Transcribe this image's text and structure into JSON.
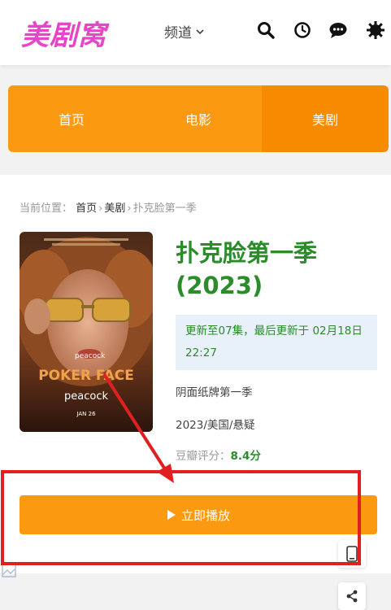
{
  "header": {
    "logo_text": "美剧窝",
    "logo_color": "#e545c6",
    "channel_label": "频道",
    "icons": [
      "search-icon",
      "history-icon",
      "chat-icon",
      "theme-icon"
    ]
  },
  "nav": {
    "items": [
      {
        "label": "首页",
        "active": false
      },
      {
        "label": "电影",
        "active": false
      },
      {
        "label": "美剧",
        "active": true
      }
    ],
    "color": "#fb9a10",
    "active_color": "#f88a00"
  },
  "breadcrumb": {
    "prefix": "当前位置：",
    "home": "首页",
    "category": "美剧",
    "current": "扑克脸第一季"
  },
  "show": {
    "title": "扑克脸第一季(2023)",
    "update_note": "更新至07集，最后更新于 02月18日 22:27",
    "alt_name": "阴面纸牌第一季",
    "meta": "2023/美国/悬疑",
    "rating_label": "豆瓣评分：",
    "rating_value": "8.4分"
  },
  "poster": {
    "brand": "peacock",
    "title_text": "POKER FACE",
    "date": "JAN 26"
  },
  "actions": {
    "play_label": "立即播放"
  },
  "accent_green": "#2a8c2a",
  "annotation_color": "#e02020"
}
